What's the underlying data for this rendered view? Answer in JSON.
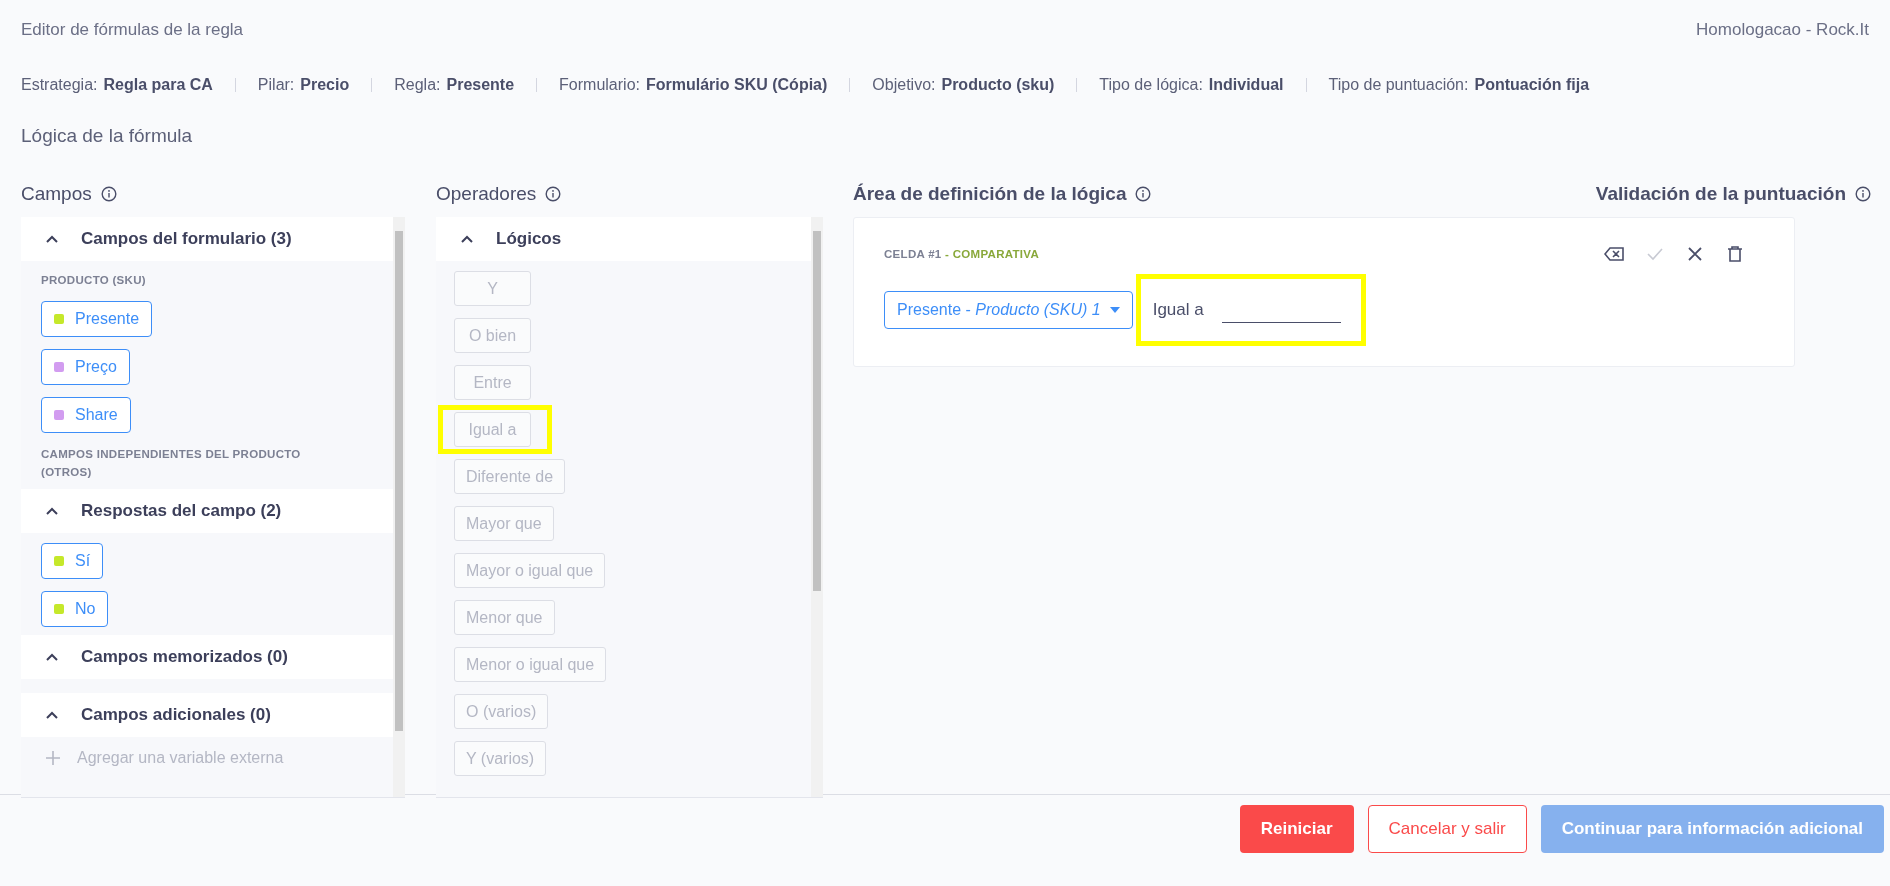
{
  "header": {
    "title": "Editor de fórmulas de la regla",
    "workspace": "Homologacao - Rock.It"
  },
  "info": [
    {
      "label": "Estrategia:",
      "value": "Regla para CA"
    },
    {
      "label": "Pilar:",
      "value": "Precio"
    },
    {
      "label": "Regla:",
      "value": "Presente"
    },
    {
      "label": "Formulario:",
      "value": "Formulário SKU (Cópia)"
    },
    {
      "label": "Objetivo:",
      "value": "Producto (sku)"
    },
    {
      "label": "Tipo de lógica:",
      "value": "Individual"
    },
    {
      "label": "Tipo de puntuación:",
      "value": "Pontuación fija"
    }
  ],
  "section_title": "Lógica de la fórmula",
  "fields_panel": {
    "title": "Campos",
    "sections": [
      {
        "title": "Campos del formulario (3)",
        "expanded": true,
        "groups": [
          {
            "label": "PRODUCTO (SKU)",
            "items": [
              {
                "label": "Presente",
                "color": "#c5e82a"
              },
              {
                "label": "Preço",
                "color": "#d29cf0"
              },
              {
                "label": "Share",
                "color": "#d29cf0"
              }
            ]
          },
          {
            "label": "CAMPOS INDEPENDIENTES DEL PRODUCTO (OTROS)"
          }
        ]
      },
      {
        "title": "Respostas del campo (2)",
        "expanded": true,
        "groups": [
          {
            "items": [
              {
                "label": "Sí",
                "color": "#c5e82a"
              },
              {
                "label": "No",
                "color": "#c5e82a"
              }
            ]
          }
        ]
      },
      {
        "title": "Campos memorizados (0)",
        "expanded": true
      },
      {
        "title": "Campos adicionales (0)",
        "expanded": true,
        "add_label": "Agregar una variable externa"
      }
    ]
  },
  "operators_panel": {
    "title": "Operadores",
    "sections": [
      {
        "title": "Lógicos",
        "expanded": true,
        "items": [
          {
            "label": "Y",
            "disabled": true,
            "highlighted": false
          },
          {
            "label": "O bien",
            "disabled": true,
            "highlighted": false
          },
          {
            "label": "Entre",
            "disabled": true,
            "highlighted": false
          },
          {
            "label": "Igual a",
            "disabled": true,
            "highlighted": true
          },
          {
            "label": "Diferente de",
            "disabled": true,
            "highlighted": false
          },
          {
            "label": "Mayor que",
            "disabled": true,
            "highlighted": false
          },
          {
            "label": "Mayor o igual que",
            "disabled": true,
            "highlighted": false
          },
          {
            "label": "Menor que",
            "disabled": true,
            "highlighted": false
          },
          {
            "label": "Menor o igual que",
            "disabled": true,
            "highlighted": false
          },
          {
            "label": "O (varios)",
            "disabled": true,
            "highlighted": false
          },
          {
            "label": "Y (varios)",
            "disabled": true,
            "highlighted": false
          }
        ]
      }
    ]
  },
  "logic_area": {
    "title": "Área de definición de la lógica",
    "cells": [
      {
        "label": "CELDA #1",
        "type": "- COMPARATIVA",
        "actions": [
          {
            "kind": "backspace",
            "disabled": false
          },
          {
            "kind": "check",
            "disabled": true
          },
          {
            "kind": "close",
            "disabled": false
          },
          {
            "kind": "trash",
            "disabled": false
          }
        ],
        "field": "Presente - *Producto (SKU) 1*",
        "operator": "Igual a",
        "highlighted": true
      }
    ]
  },
  "validation": {
    "title": "Validación de la puntuación"
  },
  "footer": {
    "buttons": [
      {
        "label": "Reiniciar",
        "kind": "danger",
        "disabled": false
      },
      {
        "label": "Cancelar y salir",
        "kind": "outline",
        "disabled": false
      },
      {
        "label": "Continuar para información adicional",
        "kind": "primary",
        "disabled": true
      }
    ]
  }
}
